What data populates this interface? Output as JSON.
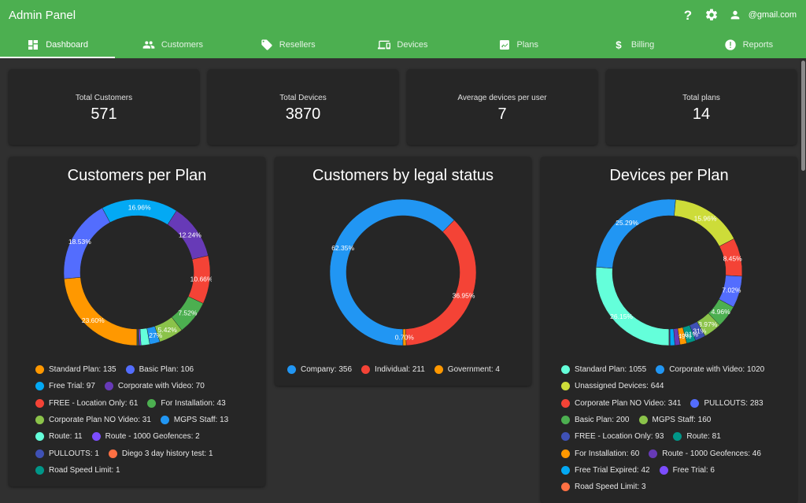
{
  "app": {
    "title": "Admin Panel",
    "user_email": "@gmail.com"
  },
  "tabs": [
    {
      "label": "Dashboard",
      "icon": "dashboard-icon"
    },
    {
      "label": "Customers",
      "icon": "people-icon"
    },
    {
      "label": "Resellers",
      "icon": "tag-icon"
    },
    {
      "label": "Devices",
      "icon": "devices-icon"
    },
    {
      "label": "Plans",
      "icon": "plans-icon"
    },
    {
      "label": "Billing",
      "icon": "dollar-icon"
    },
    {
      "label": "Reports",
      "icon": "report-icon"
    }
  ],
  "stats": [
    {
      "label": "Total Customers",
      "value": "571"
    },
    {
      "label": "Total Devices",
      "value": "3870"
    },
    {
      "label": "Average devices per user",
      "value": "7"
    },
    {
      "label": "Total plans",
      "value": "14"
    }
  ],
  "chart_data": [
    {
      "type": "pie",
      "title": "Customers per Plan",
      "start_angle": 90,
      "legend_position": "bottom",
      "slices": [
        {
          "label": "Standard Plan",
          "value": 135,
          "pct": "23.60%",
          "color": "#ff9800"
        },
        {
          "label": "Basic Plan",
          "value": 106,
          "pct": "18.53%",
          "color": "#536dfe"
        },
        {
          "label": "Free Trial",
          "value": 97,
          "pct": "16.96%",
          "color": "#03a9f4"
        },
        {
          "label": "Corporate with Video",
          "value": 70,
          "pct": "12.24%",
          "color": "#673ab7"
        },
        {
          "label": "FREE - Location Only",
          "value": 61,
          "pct": "10.66%",
          "color": "#f44336"
        },
        {
          "label": "For Installation",
          "value": 43,
          "pct": "7.52%",
          "color": "#4caf50"
        },
        {
          "label": "Corporate Plan NO Video",
          "value": 31,
          "pct": "5.42%",
          "color": "#8bc34a"
        },
        {
          "label": "MGPS Staff",
          "value": 13,
          "pct": "2.27%",
          "color": "#2196f3"
        },
        {
          "label": "Route",
          "value": 11,
          "pct": "",
          "color": "#64ffda"
        },
        {
          "label": "Route - 1000 Geofences",
          "value": 2,
          "pct": "",
          "color": "#7c4dff"
        },
        {
          "label": "PULLOUTS",
          "value": 1,
          "pct": "",
          "color": "#3f51b5"
        },
        {
          "label": "Diego 3 day history test",
          "value": 1,
          "pct": "",
          "color": "#ff7043"
        },
        {
          "label": "Road Speed Limit",
          "value": 1,
          "pct": "",
          "color": "#009688"
        }
      ]
    },
    {
      "type": "pie",
      "title": "Customers by legal status",
      "start_angle": 90,
      "legend_position": "bottom",
      "slices": [
        {
          "label": "Company",
          "value": 356,
          "pct": "62.35%",
          "color": "#2196f3"
        },
        {
          "label": "Individual",
          "value": 211,
          "pct": "36.95%",
          "color": "#f44336"
        },
        {
          "label": "Government",
          "value": 4,
          "pct": "0.70%",
          "color": "#ff9800"
        }
      ]
    },
    {
      "type": "pie",
      "title": "Devices per Plan",
      "start_angle": 90,
      "legend_position": "bottom",
      "slices": [
        {
          "label": "Standard Plan",
          "value": 1055,
          "pct": "26.15%",
          "color": "#64ffda"
        },
        {
          "label": "Corporate with Video",
          "value": 1020,
          "pct": "25.29%",
          "color": "#2196f3"
        },
        {
          "label": "Unassigned Devices",
          "value": 644,
          "pct": "15.96%",
          "color": "#cddc39"
        },
        {
          "label": "Corporate Plan NO Video",
          "value": 341,
          "pct": "8.45%",
          "color": "#f44336"
        },
        {
          "label": "PULLOUTS",
          "value": 283,
          "pct": "7.02%",
          "color": "#536dfe"
        },
        {
          "label": "Basic Plan",
          "value": 200,
          "pct": "4.96%",
          "color": "#4caf50"
        },
        {
          "label": "MGPS Staff",
          "value": 160,
          "pct": "3.97%",
          "color": "#8bc34a"
        },
        {
          "label": "FREE - Location Only",
          "value": 93,
          "pct": "2.31%",
          "color": "#3f51b5"
        },
        {
          "label": "Route",
          "value": 81,
          "pct": "2.01%",
          "color": "#009688"
        },
        {
          "label": "For Installation",
          "value": 60,
          "pct": "1.49%",
          "color": "#ff9800"
        },
        {
          "label": "Route - 1000 Geofences",
          "value": 46,
          "pct": "",
          "color": "#673ab7"
        },
        {
          "label": "Free Trial Expired",
          "value": 42,
          "pct": "",
          "color": "#03a9f4"
        },
        {
          "label": "Free Trial",
          "value": 6,
          "pct": "",
          "color": "#7c4dff"
        },
        {
          "label": "Road Speed Limit",
          "value": 3,
          "pct": "",
          "color": "#ff7043"
        }
      ]
    }
  ]
}
